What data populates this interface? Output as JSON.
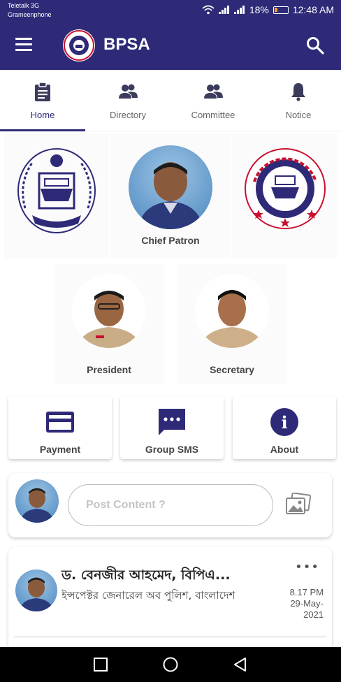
{
  "status_bar": {
    "carrier_1": "Teletalk 3G",
    "carrier_2": "Grameenphone",
    "battery": "18%",
    "time": "12:48 AM"
  },
  "app_bar": {
    "title": "BPSA",
    "background": "#2e2a78"
  },
  "tabs": [
    {
      "label": "Home",
      "icon": "clipboard-icon",
      "active": true
    },
    {
      "label": "Directory",
      "icon": "people-icon"
    },
    {
      "label": "Committee",
      "icon": "people-icon"
    },
    {
      "label": "Notice",
      "icon": "bell-icon"
    }
  ],
  "leaders": {
    "chief_patron": "Chief Patron",
    "president": "President",
    "secretary": "Secretary"
  },
  "actions": {
    "payment": "Payment",
    "group_sms": "Group SMS",
    "about": "About",
    "about_glyph": "i"
  },
  "composer": {
    "placeholder": "Post Content ?"
  },
  "post": {
    "author": "ড. বেনজীর আহমেদ, বিপিএ...",
    "designation": "ইন্সপেক্টর জেনারেল অব পুলিশ, বাংলাদেশ",
    "time": "8.17 PM",
    "date": "29-May-",
    "year": "2021",
    "more": "•••"
  },
  "colors": {
    "primary": "#2e2a78",
    "seal_red": "#c8102e"
  }
}
